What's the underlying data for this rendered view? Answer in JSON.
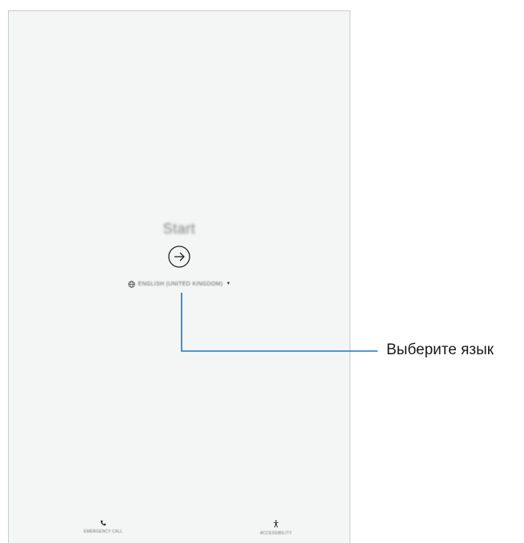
{
  "screen": {
    "title": "Start",
    "language": {
      "selected": "ENGLISH (UNITED KINGDOM)"
    },
    "bottom_bar": {
      "emergency_label": "EMERGENCY CALL",
      "accessibility_label": "ACCESSIBILITY"
    }
  },
  "annotation": {
    "label": "Выберите язык"
  },
  "icons": {
    "start": "arrow-right-circle-icon",
    "language": "globe-icon",
    "emergency": "phone-icon",
    "accessibility": "accessibility-person-icon",
    "caret": "caret-down-icon"
  },
  "colors": {
    "screen_background": "#f4f6f5",
    "leader_line": "#1677c7"
  }
}
